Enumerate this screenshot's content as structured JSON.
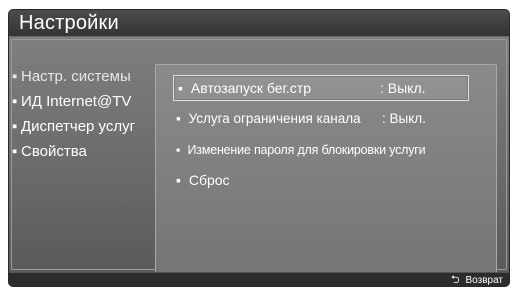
{
  "title": "Настройки",
  "menu": {
    "items": [
      {
        "label": "Настр. системы",
        "selected": true
      },
      {
        "label": "ИД Internet@TV",
        "selected": false
      },
      {
        "label": "Диспетчер услуг",
        "selected": false
      },
      {
        "label": "Свойства",
        "selected": false
      }
    ]
  },
  "options": [
    {
      "label": "Автозапуск бег.стр",
      "value": ": Выкл."
    },
    {
      "label": "Услуга ограничения канала",
      "value": ": Выкл."
    },
    {
      "label": "Изменение пароля для блокировки услуги",
      "value": ""
    },
    {
      "label": "Сброс",
      "value": ""
    }
  ],
  "bullet": "▪",
  "footer": {
    "return_icon": "return-arrow-icon",
    "return_label": "Возврат"
  }
}
